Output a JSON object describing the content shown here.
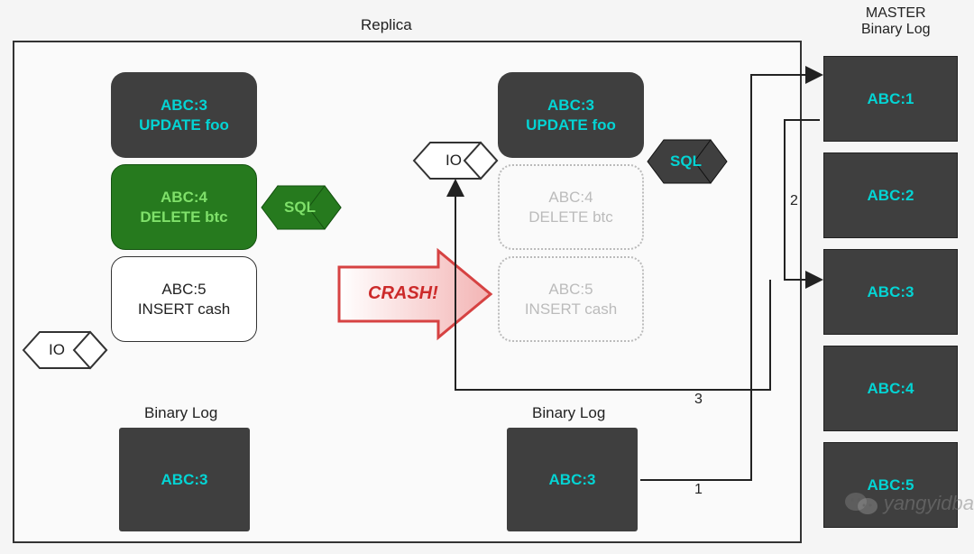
{
  "titles": {
    "replica": "Replica",
    "master": "MASTER\nBinary Log"
  },
  "left_stack": {
    "b1": {
      "id": "ABC:3",
      "op": "UPDATE foo"
    },
    "b2": {
      "id": "ABC:4",
      "op": "DELETE btc"
    },
    "b3": {
      "id": "ABC:5",
      "op": "INSERT cash"
    }
  },
  "right_stack": {
    "b1": {
      "id": "ABC:3",
      "op": "UPDATE foo"
    },
    "b2": {
      "id": "ABC:4",
      "op": "DELETE btc"
    },
    "b3": {
      "id": "ABC:5",
      "op": "INSERT cash"
    }
  },
  "tags": {
    "sql_left": "SQL",
    "sql_right": "SQL",
    "io_left": "IO",
    "io_right": "IO"
  },
  "crash": "CRASH!",
  "binlog_label_left": "Binary Log",
  "binlog_label_right": "Binary Log",
  "binlog_left": "ABC:3",
  "binlog_right": "ABC:3",
  "master_entries": [
    "ABC:1",
    "ABC:2",
    "ABC:3",
    "ABC:4",
    "ABC:5"
  ],
  "conn_labels": {
    "n1": "1",
    "n2": "2",
    "n3": "3"
  },
  "watermark": "yangyidba"
}
